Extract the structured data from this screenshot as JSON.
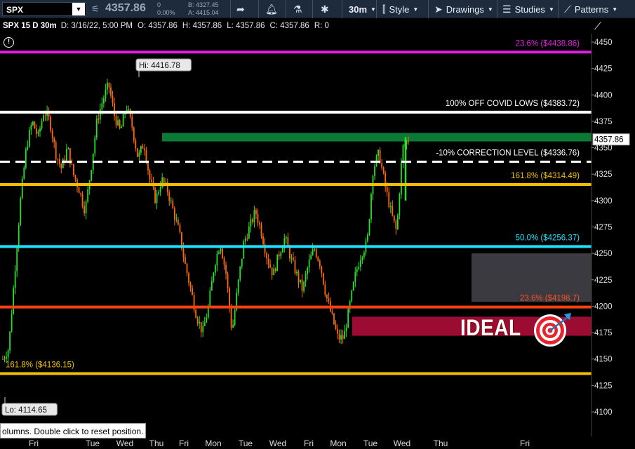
{
  "toolbar": {
    "symbol": "SPX",
    "last_price": "4357.86",
    "change": "0",
    "change_pct": "0.00%",
    "bid": "B: 4327.45",
    "ask": "A: 4415.04",
    "timeframe": "30m",
    "style_label": "Style",
    "drawings_label": "Drawings",
    "studies_label": "Studies",
    "patterns_label": "Patterns"
  },
  "info": {
    "title": "SPX 15 D 30m",
    "date": "D: 3/16/22, 5:00 PM",
    "open": "O: 4357.86",
    "high": "H: 4357.86",
    "low": "L: 4357.86",
    "close": "C: 4357.86",
    "range": "R: 0"
  },
  "levels": [
    {
      "label": "23.6%  ($4438.86)",
      "price": 4440.5,
      "color": "#e020e0",
      "label_color": "#e020e0",
      "style": "solid"
    },
    {
      "label": "100% OFF COVID LOWS ($4383.72)",
      "price": 4383.7,
      "color": "#ffffff",
      "label_color": "#ffffff",
      "style": "solid"
    },
    {
      "label": "-10% CORRECTION LEVEL  ($4336.76)",
      "price": 4336.8,
      "color": "#ffffff",
      "label_color": "#ffffff",
      "style": "dashed"
    },
    {
      "label": "161.8%  ($4314.49)",
      "price": 4315.2,
      "color": "#f0c000",
      "label_color": "#f0c000",
      "style": "solid"
    },
    {
      "label": "50.0%  ($4256.37)",
      "price": 4256.5,
      "color": "#20e0ff",
      "label_color": "#20e0ff",
      "style": "solid"
    },
    {
      "label": "23.6%  ($4198.7)",
      "price": 4199.2,
      "color": "#ff4010",
      "label_color": "#ff5020",
      "style": "solid"
    },
    {
      "label": "161.8%  ($4136.15)",
      "price": 4136.2,
      "color": "#f0c000",
      "label_color": "#f0c000",
      "style": "solid"
    }
  ],
  "annotations": {
    "hi_label": "Hi: 4416.78",
    "lo_label": "Lo: 4114.65",
    "ideal_label": "IDEAL",
    "price_tag": "4357.86"
  },
  "chart_data": {
    "type": "candlestick",
    "y_ticks": [
      4450,
      4425,
      4400,
      4375,
      4350,
      4325,
      4300,
      4275,
      4250,
      4225,
      4200,
      4175,
      4150,
      4125,
      4100
    ],
    "ylim": [
      4082,
      4460
    ],
    "x_ticks": [
      "Fri",
      "Tue",
      "Wed",
      "Thu",
      "Fri",
      "Mon",
      "Tue",
      "Wed",
      "Fri",
      "Mon",
      "Tue",
      "Wed",
      "Thu",
      "Fri"
    ],
    "high": 4416.78,
    "low": 4114.65,
    "last": 4357.86,
    "zones": [
      {
        "name": "green-zone",
        "from": 4356,
        "to": 4364,
        "color": "#0b7a36"
      },
      {
        "name": "gray-zone",
        "from": 4204,
        "to": 4250,
        "color": "#3a3a40"
      },
      {
        "name": "ideal-zone",
        "from": 4172,
        "to": 4190,
        "color": "#9c0b32"
      }
    ],
    "path": [
      4150,
      4160,
      4230,
      4300,
      4350,
      4375,
      4360,
      4385,
      4375,
      4345,
      4330,
      4350,
      4325,
      4310,
      4290,
      4330,
      4375,
      4395,
      4410,
      4380,
      4365,
      4390,
      4370,
      4340,
      4355,
      4320,
      4300,
      4320,
      4310,
      4290,
      4270,
      4240,
      4215,
      4190,
      4175,
      4200,
      4240,
      4260,
      4230,
      4175,
      4220,
      4260,
      4275,
      4290,
      4270,
      4245,
      4230,
      4250,
      4265,
      4245,
      4230,
      4215,
      4240,
      4255,
      4240,
      4210,
      4190,
      4170,
      4170,
      4200,
      4230,
      4250,
      4260,
      4330,
      4345,
      4315,
      4290,
      4270,
      4350,
      4358
    ]
  },
  "status_tip": "olumns. Double click to reset position.",
  "colors": {
    "toolbar_bg": "#1e2b3c",
    "bull": "#2adf2a",
    "bear": "#ff6a00"
  }
}
